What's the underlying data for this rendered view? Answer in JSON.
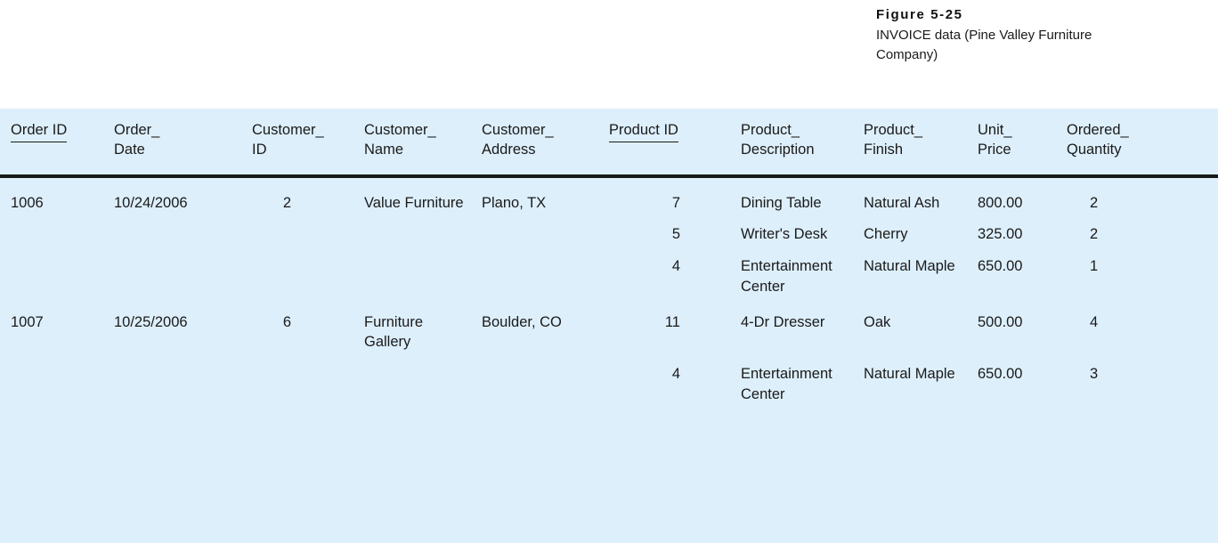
{
  "caption": {
    "figure_number": "Figure 5-25",
    "text": "INVOICE data (Pine Valley Furniture Company)"
  },
  "colors": {
    "panel_background": "#ddeffb",
    "page_background": "#ffffff",
    "text": "#1a1a1a",
    "header_rule": "#181818"
  },
  "table": {
    "columns": [
      {
        "label_line1": "Order ID",
        "label_line2": "",
        "is_key": true,
        "align": "left"
      },
      {
        "label_line1": "Order_",
        "label_line2": "Date",
        "is_key": false,
        "align": "left"
      },
      {
        "label_line1": "Customer_",
        "label_line2": "ID",
        "is_key": false,
        "align": "right"
      },
      {
        "label_line1": "Customer_",
        "label_line2": "Name",
        "is_key": false,
        "align": "left"
      },
      {
        "label_line1": "Customer_",
        "label_line2": "Address",
        "is_key": false,
        "align": "left"
      },
      {
        "label_line1": "Product ID",
        "label_line2": "",
        "is_key": true,
        "align": "right"
      },
      {
        "label_line1": "Product_",
        "label_line2": "Description",
        "is_key": false,
        "align": "left"
      },
      {
        "label_line1": "Product_",
        "label_line2": "Finish",
        "is_key": false,
        "align": "left"
      },
      {
        "label_line1": "Unit_",
        "label_line2": "Price",
        "is_key": false,
        "align": "left"
      },
      {
        "label_line1": "Ordered_",
        "label_line2": "Quantity",
        "is_key": false,
        "align": "left"
      }
    ],
    "rows": [
      {
        "order_id": "1006",
        "order_date": "10/24/2006",
        "customer_id": "2",
        "customer_name": "Value Furniture",
        "customer_address": "Plano, TX",
        "product_id": "7",
        "product_description": "Dining Table",
        "product_finish": "Natural Ash",
        "unit_price": "800.00",
        "ordered_quantity": "2"
      },
      {
        "order_id": "",
        "order_date": "",
        "customer_id": "",
        "customer_name": "",
        "customer_address": "",
        "product_id": "5",
        "product_description": "Writer's Desk",
        "product_finish": "Cherry",
        "unit_price": "325.00",
        "ordered_quantity": "2"
      },
      {
        "order_id": "",
        "order_date": "",
        "customer_id": "",
        "customer_name": "",
        "customer_address": "",
        "product_id": "4",
        "product_description": "Entertainment Center",
        "product_finish": "Natural Maple",
        "unit_price": "650.00",
        "ordered_quantity": "1"
      },
      {
        "order_id": "1007",
        "order_date": "10/25/2006",
        "customer_id": "6",
        "customer_name": "Furniture Gallery",
        "customer_address": "Boulder, CO",
        "product_id": "11",
        "product_description": "4-Dr Dresser",
        "product_finish": "Oak",
        "unit_price": "500.00",
        "ordered_quantity": "4"
      },
      {
        "order_id": "",
        "order_date": "",
        "customer_id": "",
        "customer_name": "",
        "customer_address": "",
        "product_id": "4",
        "product_description": "Entertainment Center",
        "product_finish": "Natural Maple",
        "unit_price": "650.00",
        "ordered_quantity": "3"
      }
    ]
  }
}
